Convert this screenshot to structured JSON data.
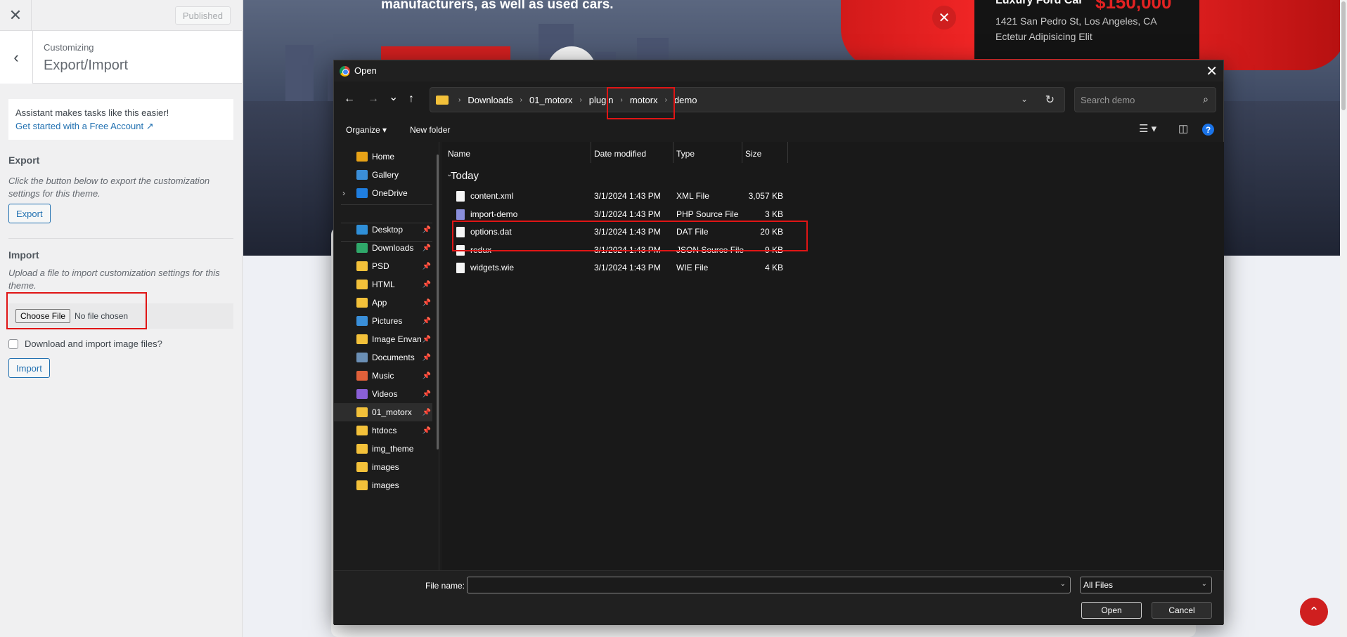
{
  "customizer": {
    "close_glyph": "✕",
    "published_label": "Published",
    "back_glyph": "‹",
    "customizing_label": "Customizing",
    "section_title": "Export/Import",
    "notice_text": "Assistant makes tasks like this easier!",
    "notice_link": "Get started with a Free Account",
    "export_heading": "Export",
    "export_desc": "Click the button below to export the customization settings for this theme.",
    "export_button": "Export",
    "import_heading": "Import",
    "import_desc": "Upload a file to import customization settings for this theme.",
    "choose_file_label": "Choose File",
    "no_file_text": "No file chosen",
    "download_images_label": "Download and import image files?",
    "download_images_checked": false,
    "import_button": "Import"
  },
  "site": {
    "hero_text": "manufacturers, as well as used cars.",
    "car_name": "Luxury Ford Car",
    "car_price": "$150,000",
    "car_address": "1421 San Pedro St, Los Angeles, CA",
    "car_subtitle": "Ectetur Adipisicing Elit",
    "close_glyph": "✕",
    "scroll_top_glyph": "⌃"
  },
  "dialog": {
    "title": "Open",
    "close_glyph": "✕",
    "nav": {
      "back": "←",
      "forward": "→",
      "recent": "⌄",
      "up": "↑",
      "refresh": "↻",
      "search_icon": "⌕",
      "address_dropdown": "⌄"
    },
    "breadcrumb": [
      "Downloads",
      "01_motorx",
      "plugin",
      "motorx",
      "demo"
    ],
    "search_placeholder": "Search demo",
    "organize_label": "Organize ▾",
    "new_folder_label": "New folder",
    "view_icon": "☰ ▾",
    "preview_icon": "◫",
    "help_icon": "?",
    "nav_items": [
      {
        "label": "Home",
        "pinned": false,
        "icon": "home-icon",
        "color": "#e8a317"
      },
      {
        "label": "Gallery",
        "pinned": false,
        "icon": "gallery-icon",
        "color": "#3b8fd9"
      },
      {
        "label": "OneDrive",
        "pinned": false,
        "icon": "onedrive-icon",
        "color": "#1f7ee0",
        "expandable": true
      },
      {
        "label": "Desktop",
        "pinned": true,
        "icon": "desktop-icon",
        "color": "#2f8fd8"
      },
      {
        "label": "Downloads",
        "pinned": true,
        "icon": "downloads-icon",
        "color": "#2fa86a"
      },
      {
        "label": "PSD",
        "pinned": true,
        "icon": "folder-icon",
        "color": "#f3c13a"
      },
      {
        "label": "HTML",
        "pinned": true,
        "icon": "folder-icon",
        "color": "#f3c13a"
      },
      {
        "label": "App",
        "pinned": true,
        "icon": "folder-icon",
        "color": "#f3c13a"
      },
      {
        "label": "Pictures",
        "pinned": true,
        "icon": "pictures-icon",
        "color": "#3a8fd9"
      },
      {
        "label": "Image Envan",
        "pinned": true,
        "icon": "folder-icon",
        "color": "#f3c13a"
      },
      {
        "label": "Documents",
        "pinned": true,
        "icon": "documents-icon",
        "color": "#6b8fb5"
      },
      {
        "label": "Music",
        "pinned": true,
        "icon": "music-icon",
        "color": "#e0603a"
      },
      {
        "label": "Videos",
        "pinned": true,
        "icon": "videos-icon",
        "color": "#8a5fd6"
      },
      {
        "label": "01_motorx",
        "pinned": true,
        "icon": "folder-icon",
        "color": "#f3c13a",
        "selected": true
      },
      {
        "label": "htdocs",
        "pinned": true,
        "icon": "folder-icon",
        "color": "#f3c13a"
      },
      {
        "label": "img_theme",
        "pinned": false,
        "icon": "folder-icon",
        "color": "#f3c13a"
      },
      {
        "label": "images",
        "pinned": false,
        "icon": "folder-icon",
        "color": "#f3c13a"
      },
      {
        "label": "images",
        "pinned": false,
        "icon": "folder-icon",
        "color": "#f3c13a"
      }
    ],
    "columns": [
      "Name",
      "Date modified",
      "Type",
      "Size"
    ],
    "group_label": "Today",
    "group_chevron": "⌄",
    "files": [
      {
        "name": "content.xml",
        "date": "3/1/2024 1:43 PM",
        "type": "XML File",
        "size": "3,057 KB",
        "icon": "file-icon"
      },
      {
        "name": "import-demo",
        "date": "3/1/2024 1:43 PM",
        "type": "PHP Source File",
        "size": "3 KB",
        "icon": "php-file-icon"
      },
      {
        "name": "options.dat",
        "date": "3/1/2024 1:43 PM",
        "type": "DAT File",
        "size": "20 KB",
        "icon": "file-icon"
      },
      {
        "name": "redux",
        "date": "3/1/2024 1:43 PM",
        "type": "JSON Source File",
        "size": "9 KB",
        "icon": "file-icon"
      },
      {
        "name": "widgets.wie",
        "date": "3/1/2024 1:43 PM",
        "type": "WIE File",
        "size": "4 KB",
        "icon": "file-icon"
      }
    ],
    "file_name_label": "File name:",
    "file_name_value": "",
    "file_type_value": "All Files",
    "open_button": "Open",
    "cancel_button": "Cancel"
  },
  "colors": {
    "accent_red": "#e01515",
    "wp_blue": "#2271b1",
    "dialog_bg": "#1c1c1c"
  }
}
